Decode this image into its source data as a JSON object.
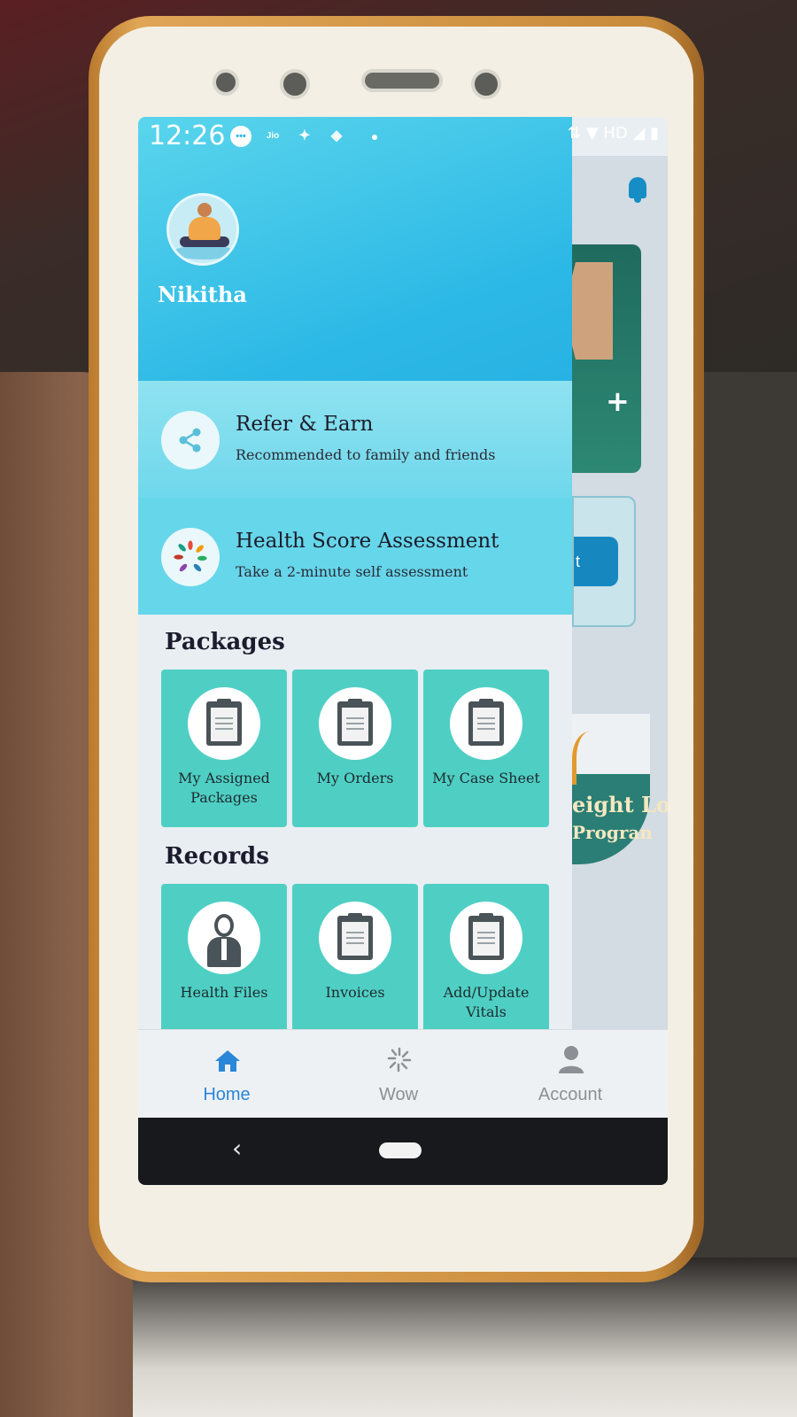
{
  "status_bar": {
    "time": "12:26",
    "network": "HD"
  },
  "drawer": {
    "user_name": "Nikitha",
    "menu": [
      {
        "title": "Refer & Earn",
        "subtitle": "Recommended to family and friends",
        "icon": "share-icon"
      },
      {
        "title": "Health Score Assessment",
        "subtitle": "Take a 2-minute self assessment",
        "icon": "health-score-icon"
      }
    ],
    "packages": {
      "title": "Packages",
      "items": [
        {
          "label": "My Assigned Packages",
          "icon": "clipboard-icon"
        },
        {
          "label": "My Orders",
          "icon": "clipboard-icon"
        },
        {
          "label": "My Case Sheet",
          "icon": "clipboard-icon"
        }
      ]
    },
    "records": {
      "title": "Records",
      "items": [
        {
          "label": "Health Files",
          "icon": "doctor-icon"
        },
        {
          "label": "Invoices",
          "icon": "clipboard-icon"
        },
        {
          "label": "Add/Update Vitals",
          "icon": "clipboard-icon"
        }
      ]
    }
  },
  "background_page": {
    "banner_text_1": "eight Lo",
    "banner_text_2": "Progran",
    "button_fragment": "t"
  },
  "bottom_nav": {
    "items": [
      {
        "label": "Home",
        "icon": "home-icon",
        "active": true
      },
      {
        "label": "Wow",
        "icon": "wow-icon",
        "active": false
      },
      {
        "label": "Account",
        "icon": "account-icon",
        "active": false
      }
    ],
    "active_color": "#2a86d8",
    "inactive_color": "#8c8f93"
  },
  "colors": {
    "drawer_header": "#2db9e6",
    "tile": "#4fcfc4"
  }
}
